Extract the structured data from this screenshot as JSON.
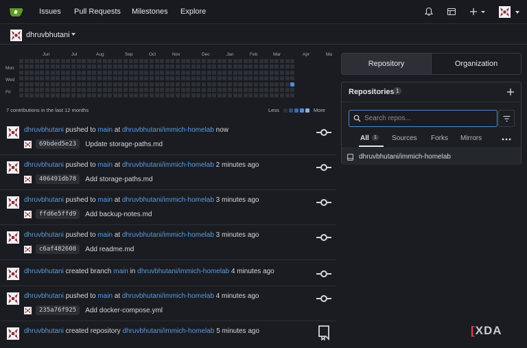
{
  "nav": {
    "links": [
      "Issues",
      "Pull Requests",
      "Milestones",
      "Explore"
    ]
  },
  "context": {
    "user": "dhruvbhutani"
  },
  "heatmap": {
    "months": [
      "Jun",
      "Jul",
      "Aug",
      "Sep",
      "Oct",
      "Nov",
      "Dec",
      "Jan",
      "Feb",
      "Mar",
      "Apr",
      "Ma"
    ],
    "days": [
      "Mon",
      "Wed",
      "Fri"
    ],
    "active_cell_color": "#4d8ed9",
    "summary": "7 contributions in the last 12 months",
    "legend_less": "Less",
    "legend_more": "More"
  },
  "feed": [
    {
      "user": "dhruvbhutani",
      "action": "pushed to",
      "branch": "main",
      "prep": "at",
      "repo": "dhruvbhutani/immich-homelab",
      "time": "now",
      "sha": "69bded5e23",
      "message": "Update storage-paths.md",
      "icon": "commit-icon"
    },
    {
      "user": "dhruvbhutani",
      "action": "pushed to",
      "branch": "main",
      "prep": "at",
      "repo": "dhruvbhutani/immich-homelab",
      "time": "2 minutes ago",
      "sha": "406491db78",
      "message": "Add storage-paths.md",
      "icon": "commit-icon"
    },
    {
      "user": "dhruvbhutani",
      "action": "pushed to",
      "branch": "main",
      "prep": "at",
      "repo": "dhruvbhutani/immich-homelab",
      "time": "3 minutes ago",
      "sha": "ffd6e5ffd9",
      "message": "Add backup-notes.md",
      "icon": "commit-icon"
    },
    {
      "user": "dhruvbhutani",
      "action": "pushed to",
      "branch": "main",
      "prep": "at",
      "repo": "dhruvbhutani/immich-homelab",
      "time": "3 minutes ago",
      "sha": "c6af482608",
      "message": "Add readme.md",
      "icon": "commit-icon"
    },
    {
      "user": "dhruvbhutani",
      "action": "created branch",
      "branch": "main",
      "prep": "in",
      "repo": "dhruvbhutani/immich-homelab",
      "time": "4 minutes ago",
      "icon": "commit-icon"
    },
    {
      "user": "dhruvbhutani",
      "action": "pushed to",
      "branch": "main",
      "prep": "at",
      "repo": "dhruvbhutani/immich-homelab",
      "time": "4 minutes ago",
      "sha": "235a76f925",
      "message": "Add docker-compose.yml",
      "icon": "commit-icon"
    },
    {
      "user": "dhruvbhutani",
      "action": "created repository",
      "prep": "",
      "repo": "dhruvbhutani/immich-homelab",
      "time": "5 minutes ago",
      "icon": "repo-bookmark-icon"
    }
  ],
  "right": {
    "tabs": [
      "Repository",
      "Organization"
    ],
    "panel_title": "Repositories",
    "panel_count": "1",
    "search_placeholder": "Search repos...",
    "subtabs": [
      "All",
      "Sources",
      "Forks",
      "Mirrors"
    ],
    "all_count": "1",
    "repo": "dhruvbhutani/immich-homelab"
  },
  "watermark": {
    "bracket": "[",
    "text": "XDA"
  }
}
